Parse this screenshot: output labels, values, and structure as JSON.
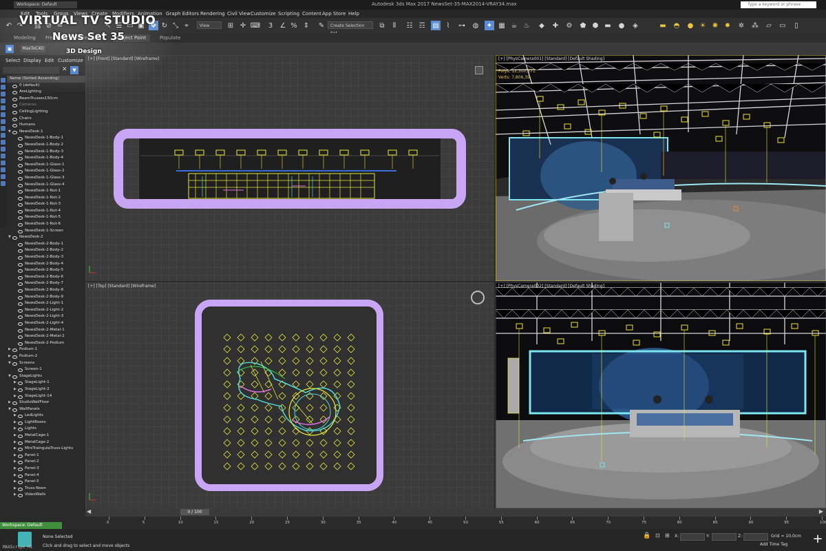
{
  "titlebar": {
    "workspace": "Workspace: Default",
    "title": "Autodesk 3ds Max 2017      NewsSet-35-MAX2014-VRAY34.max",
    "search_placeholder": "Type a keyword or phrase"
  },
  "menu": [
    "Edit",
    "Tools",
    "Group",
    "Views",
    "Create",
    "Modifiers",
    "Animation",
    "Graph Editors",
    "Rendering",
    "Civil View",
    "Customize",
    "Scripting",
    "Content",
    "App Store",
    "Help"
  ],
  "toolbar": {
    "view_dropdown": "View",
    "selection_set": "Create Selection Set"
  },
  "ribbon": {
    "tabs": [
      "Modeling",
      "Freeform",
      "Selection",
      "Object Paint",
      "Populate"
    ],
    "selected": "Object Paint",
    "plugin": "MaxToC4D"
  },
  "overlay": {
    "line1": "VIRTUAL TV STUDIO",
    "line2": "News Set 35",
    "line3": "3D Design"
  },
  "explorer": {
    "menu": [
      "Select",
      "Display",
      "Edit",
      "Customize"
    ],
    "header": "Name (Sorted Ascending)",
    "rows": [
      {
        "label": "0 (default)",
        "indent": 1,
        "tw": ""
      },
      {
        "label": "AreLighting",
        "indent": 1,
        "tw": ""
      },
      {
        "label": "BeamTrusses150cm",
        "indent": 1,
        "tw": ""
      },
      {
        "label": "Cameras",
        "indent": 1,
        "tw": "",
        "dim": true
      },
      {
        "label": "CeilingLighting",
        "indent": 1,
        "tw": ""
      },
      {
        "label": "Chairs",
        "indent": 1,
        "tw": ""
      },
      {
        "label": "Humans",
        "indent": 1,
        "tw": ""
      },
      {
        "label": "NewsDesk-1",
        "indent": 1,
        "tw": "▼"
      },
      {
        "label": "NewsDesk-1-Body-1",
        "indent": 2,
        "tw": ""
      },
      {
        "label": "NewsDesk-1-Body-2",
        "indent": 2,
        "tw": ""
      },
      {
        "label": "NewsDesk-1-Body-3",
        "indent": 2,
        "tw": ""
      },
      {
        "label": "NewsDesk-1-Body-4",
        "indent": 2,
        "tw": ""
      },
      {
        "label": "NewsDesk-1-Glass-1",
        "indent": 2,
        "tw": ""
      },
      {
        "label": "NewsDesk-1-Glass-2",
        "indent": 2,
        "tw": ""
      },
      {
        "label": "NewsDesk-1-Glass-3",
        "indent": 2,
        "tw": ""
      },
      {
        "label": "NewsDesk-1-Glass-4",
        "indent": 2,
        "tw": ""
      },
      {
        "label": "NewsDesk-1-Nut-1",
        "indent": 2,
        "tw": ""
      },
      {
        "label": "NewsDesk-1-Nut-2",
        "indent": 2,
        "tw": ""
      },
      {
        "label": "NewsDesk-1-Nut-3",
        "indent": 2,
        "tw": ""
      },
      {
        "label": "NewsDesk-1-Nut-4",
        "indent": 2,
        "tw": ""
      },
      {
        "label": "NewsDesk-1-Nut-5",
        "indent": 2,
        "tw": ""
      },
      {
        "label": "NewsDesk-1-Nut-6",
        "indent": 2,
        "tw": ""
      },
      {
        "label": "NewsDesk-1-Screen",
        "indent": 2,
        "tw": ""
      },
      {
        "label": "NewsDesk-2",
        "indent": 1,
        "tw": "▼"
      },
      {
        "label": "NewsDesk-2-Body-1",
        "indent": 2,
        "tw": ""
      },
      {
        "label": "NewsDesk-2-Body-2",
        "indent": 2,
        "tw": ""
      },
      {
        "label": "NewsDesk-2-Body-3",
        "indent": 2,
        "tw": ""
      },
      {
        "label": "NewsDesk-2-Body-4",
        "indent": 2,
        "tw": ""
      },
      {
        "label": "NewsDesk-2-Body-5",
        "indent": 2,
        "tw": ""
      },
      {
        "label": "NewsDesk-2-Body-6",
        "indent": 2,
        "tw": ""
      },
      {
        "label": "NewsDesk-2-Body-7",
        "indent": 2,
        "tw": ""
      },
      {
        "label": "NewsDesk-2-Body-8",
        "indent": 2,
        "tw": ""
      },
      {
        "label": "NewsDesk-2-Body-9",
        "indent": 2,
        "tw": ""
      },
      {
        "label": "NewsDesk-2-Light-1",
        "indent": 2,
        "tw": ""
      },
      {
        "label": "NewsDesk-2-Light-2",
        "indent": 2,
        "tw": ""
      },
      {
        "label": "NewsDesk-2-Light-3",
        "indent": 2,
        "tw": ""
      },
      {
        "label": "NewsDesk-2-Light-4",
        "indent": 2,
        "tw": ""
      },
      {
        "label": "NewsDesk-2-Metal-1",
        "indent": 2,
        "tw": ""
      },
      {
        "label": "NewsDesk-2-Metal-2",
        "indent": 2,
        "tw": ""
      },
      {
        "label": "NewsDesk-2-Podium",
        "indent": 2,
        "tw": ""
      },
      {
        "label": "Podium-1",
        "indent": 1,
        "tw": "▶"
      },
      {
        "label": "Podium-2",
        "indent": 1,
        "tw": "▶"
      },
      {
        "label": "Screens",
        "indent": 1,
        "tw": "▼"
      },
      {
        "label": "Screen-1",
        "indent": 2,
        "tw": ""
      },
      {
        "label": "StageLights",
        "indent": 1,
        "tw": "▼"
      },
      {
        "label": "StageLight-1",
        "indent": 2,
        "tw": "▶"
      },
      {
        "label": "StageLight-2",
        "indent": 2,
        "tw": "▶"
      },
      {
        "label": "StageLight-14",
        "indent": 2,
        "tw": "▶"
      },
      {
        "label": "StudioWallFloor",
        "indent": 1,
        "tw": "▶"
      },
      {
        "label": "WallPanels",
        "indent": 1,
        "tw": "▼"
      },
      {
        "label": "LedLights",
        "indent": 2,
        "tw": "▶"
      },
      {
        "label": "LightBoxes",
        "indent": 2,
        "tw": "▶"
      },
      {
        "label": "Lights",
        "indent": 2,
        "tw": "▶"
      },
      {
        "label": "MetalCage-1",
        "indent": 2,
        "tw": "▶"
      },
      {
        "label": "MetalCage-2",
        "indent": 2,
        "tw": "▶"
      },
      {
        "label": "MiniTraingulaTruss-Lights",
        "indent": 2,
        "tw": "▶"
      },
      {
        "label": "Panel-1",
        "indent": 2,
        "tw": "▶"
      },
      {
        "label": "Panel-2",
        "indent": 2,
        "tw": "▶"
      },
      {
        "label": "Panel-3",
        "indent": 2,
        "tw": "▶"
      },
      {
        "label": "Panel-4",
        "indent": 2,
        "tw": "▶"
      },
      {
        "label": "Panel-5",
        "indent": 2,
        "tw": "▶"
      },
      {
        "label": "Truss-Neon",
        "indent": 2,
        "tw": "▶"
      },
      {
        "label": "VideoWalls",
        "indent": 2,
        "tw": "▶"
      }
    ]
  },
  "viewports": {
    "front": "[+] [Front] [Standard] [Wireframe]",
    "top": "[+] [Top] [Standard] [Wireframe]",
    "cam1": "[+] [PhysCamera001] [Standard] [Default Shading]",
    "cam2": "[+] [PhysCamera002] [Standard] [Default Shading]",
    "stats_polys": "Polys:  12,300,571",
    "stats_verts": "Verts:   7,806,39"
  },
  "timeline": {
    "frame": "0 / 100",
    "ticks": [
      0,
      5,
      10,
      15,
      20,
      25,
      30,
      35,
      40,
      45,
      50,
      55,
      60,
      65,
      70,
      75,
      80,
      85,
      90,
      95,
      100
    ]
  },
  "status": {
    "workspace": "Workspace: Default",
    "selected": "None Selected",
    "prompt": "Click and drag to select and move objects",
    "maxscript": "MAXScript Mi",
    "x": "X:",
    "y": "Y:",
    "z": "Z:",
    "grid": "Grid = 10,0cm",
    "add_time_tag": "Add Time Tag"
  },
  "colors": {
    "accent": "#5b8bd0",
    "safe_frame": "#c8a6f5",
    "wire": "#e6e83a",
    "active_border": "#d9c23a"
  }
}
